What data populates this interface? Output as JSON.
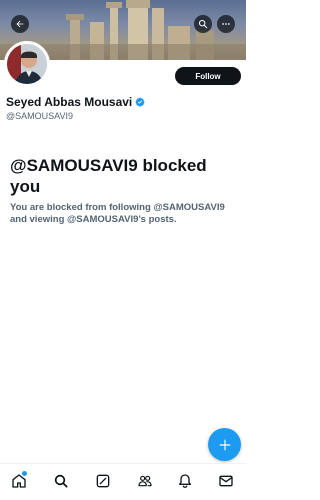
{
  "profile": {
    "name": "Seyed Abbas Mousavi",
    "handle": "@SAMOUSAVI9",
    "verified": true,
    "follow_label": "Follow"
  },
  "blocked": {
    "title": "@SAMOUSAVI9 blocked you",
    "description": "You are blocked from following @SAMOUSAVI9 and viewing @SAMOUSAVI9’s posts."
  },
  "icons": {
    "back": "arrow-left-icon",
    "search": "search-icon",
    "more": "more-horizontal-icon",
    "verified": "verified-badge-icon",
    "compose": "plus-icon",
    "nav": [
      "home-icon",
      "search-icon",
      "grok-icon",
      "communities-icon",
      "notifications-icon",
      "messages-icon"
    ]
  },
  "colors": {
    "accent": "#1d9bf0",
    "text_primary": "#0f1419",
    "text_secondary": "#536471",
    "follow_bg": "#0f1419"
  }
}
